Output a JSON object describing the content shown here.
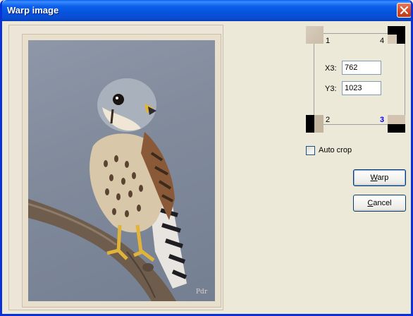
{
  "window": {
    "title": "Warp image"
  },
  "corners": [
    {
      "label": "1"
    },
    {
      "label": "4"
    },
    {
      "label": "2"
    },
    {
      "label": "3",
      "active": true
    }
  ],
  "fields": {
    "x": {
      "label": "X3:",
      "value": "762"
    },
    "y": {
      "label": "Y3:",
      "value": "1023"
    }
  },
  "auto_crop": {
    "label": "Auto crop",
    "checked": false
  },
  "buttons": {
    "warp": {
      "underline": "W",
      "rest": "arp"
    },
    "cancel": {
      "underline": "C",
      "rest": "ancel"
    }
  },
  "photo": {
    "signature": "Pdr"
  }
}
